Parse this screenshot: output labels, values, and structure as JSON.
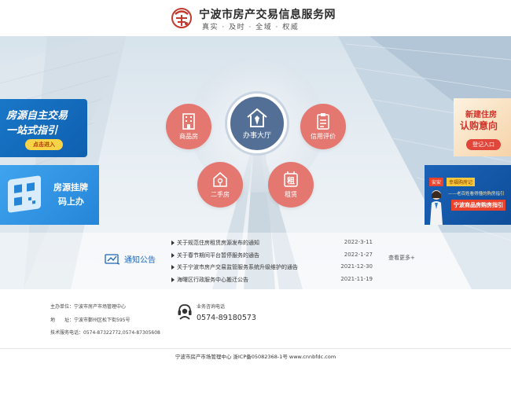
{
  "header": {
    "site_title": "宁波市房产交易信息服务网",
    "slogan": "真实 · 及时 · 全域 · 权威"
  },
  "services": {
    "hall": "办事大厅",
    "items": [
      {
        "label": "商品房",
        "icon": "building-icon"
      },
      {
        "label": "信用评价",
        "icon": "clipboard-icon"
      },
      {
        "label": "二手房",
        "icon": "key-house-icon"
      },
      {
        "label": "租赁",
        "icon": "rent-tag-icon"
      }
    ]
  },
  "banners": {
    "self_trade": {
      "line1": "房源自主交易",
      "line2": "一站式指引",
      "button": "点击进入"
    },
    "qr_listing": {
      "line1": "房源挂牌",
      "line2": "码上办"
    },
    "new_house": {
      "line1": "新建住房",
      "line2": "认购意向",
      "button": "登记入口"
    },
    "guide": {
      "tag1": "安安",
      "tag2": "幸福购房记",
      "sub": "——老百姓看得懂的购房指引",
      "main": "宁波商品房购房指引"
    }
  },
  "notice": {
    "title": "通知公告",
    "more": "查看更多+",
    "items": [
      {
        "title": "关于规范住房租赁房源发布的通知",
        "date": "2022-3-11"
      },
      {
        "title": "关于春节期间平台暂停服务的通告",
        "date": "2022-1-27"
      },
      {
        "title": "关于宁波市房产交易监管服务系统升级维护的通告",
        "date": "2021-12-30"
      },
      {
        "title": "海曙区行政服务中心搬迁公告",
        "date": "2021-11-19"
      }
    ]
  },
  "footer": {
    "sponsor": "主办单位：宁波市房产市场管理中心",
    "address_label": "地",
    "address_label2": "址：",
    "address": "宁波市鄞州区松下街595号",
    "tech_phone": "技术服务电话：0574-87322772,0574-87305608",
    "consult_title": "业务咨询电话",
    "consult_phone": "0574-89180573",
    "copyright": "宁波市房产市场管理中心 浙ICP备05082368-1号 www.cnnbfdc.com"
  },
  "colors": {
    "accent_red": "#e47870",
    "hall_blue": "#546f96",
    "notice_blue": "#1d67b5"
  }
}
